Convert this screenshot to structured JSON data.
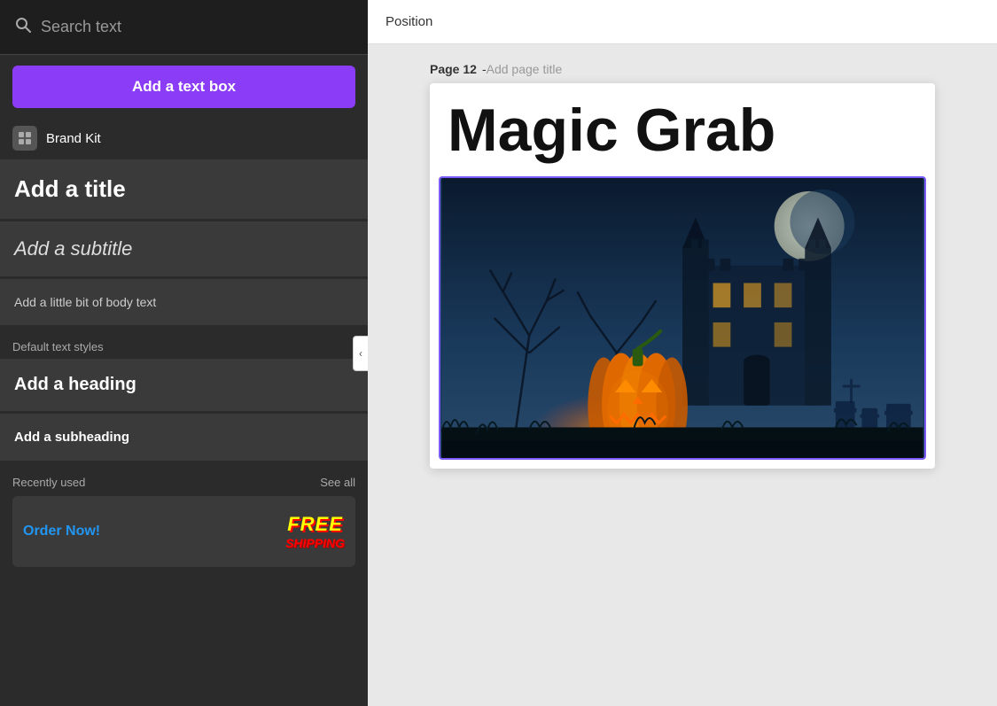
{
  "search": {
    "placeholder": "Search text",
    "icon": "search-icon"
  },
  "add_textbox_button": "Add a text box",
  "brand_kit": {
    "label": "Brand Kit",
    "icon": "brand-kit-icon"
  },
  "text_styles": {
    "title": "Add a title",
    "subtitle": "Add a subtitle",
    "body": "Add a little bit of body text"
  },
  "default_styles_label": "Default text styles",
  "default_styles": {
    "heading": "Add a heading",
    "subheading": "Add a subheading"
  },
  "recently_used": {
    "label": "Recently used",
    "see_all": "See all",
    "card_left_top": "Order Now!",
    "card_right_top": "FREE",
    "card_right_bottom": "SHIPPING"
  },
  "top_bar": {
    "position_label": "Position"
  },
  "canvas": {
    "page_number": "Page 12",
    "page_title_placeholder": "Add page title",
    "main_title": "Magic Grab"
  },
  "collapse_btn_icon": "‹"
}
